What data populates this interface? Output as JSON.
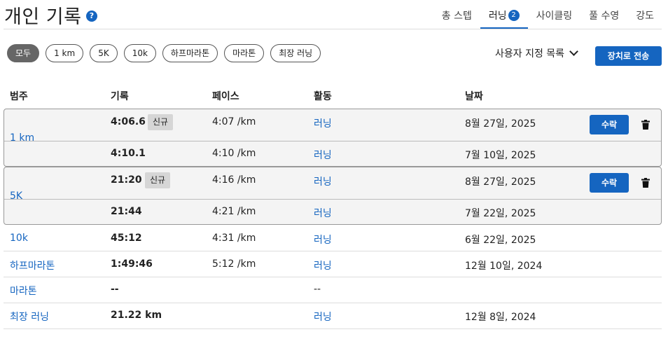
{
  "header": {
    "title": "개인 기록",
    "help_icon": "?"
  },
  "tabs": [
    {
      "label": "총 스텝"
    },
    {
      "label": "러닝",
      "badge": "2"
    },
    {
      "label": "사이클링"
    },
    {
      "label": "풀 수영"
    },
    {
      "label": "강도"
    }
  ],
  "filters": [
    "모두",
    "1 km",
    "5K",
    "10k",
    "하프마라톤",
    "마라톤",
    "최장 러닝"
  ],
  "custom_list_label": "사용자 지정 목록",
  "send_button": "장치로 전송",
  "columns": {
    "category": "범주",
    "record": "기록",
    "pace": "페이스",
    "activity": "활동",
    "date": "날짜"
  },
  "new_badge": "신규",
  "accept_label": "수락",
  "groups": [
    {
      "category": "1 km",
      "rows": [
        {
          "record": "4:06.6",
          "pace": "4:07 /km",
          "activity": "러닝",
          "date": "8월 27일, 2025"
        },
        {
          "record": "4:10.1",
          "pace": "4:10 /km",
          "activity": "러닝",
          "date": "7월 10일, 2025"
        }
      ]
    },
    {
      "category": "5K",
      "rows": [
        {
          "record": "21:20",
          "pace": "4:16 /km",
          "activity": "러닝",
          "date": "8월 27일, 2025"
        },
        {
          "record": "21:44",
          "pace": "4:21 /km",
          "activity": "러닝",
          "date": "7월 22일, 2025"
        }
      ]
    }
  ],
  "rows": [
    {
      "category": "10k",
      "record": "45:12",
      "pace": "4:31 /km",
      "activity": "러닝",
      "date": "6월 22일, 2025"
    },
    {
      "category": "하프마라톤",
      "record": "1:49:46",
      "pace": "5:12 /km",
      "activity": "러닝",
      "date": "12월 10일, 2024"
    },
    {
      "category": "마라톤",
      "record": "--",
      "pace": "",
      "activity": "--",
      "date": ""
    },
    {
      "category": "최장 러닝",
      "record": "21.22 km",
      "pace": "",
      "activity": "러닝",
      "date": "12월 8일, 2024"
    }
  ],
  "colors": {
    "accent": "#1565c0",
    "chip_active": "#666666",
    "group_bg": "#f4f4f4"
  }
}
